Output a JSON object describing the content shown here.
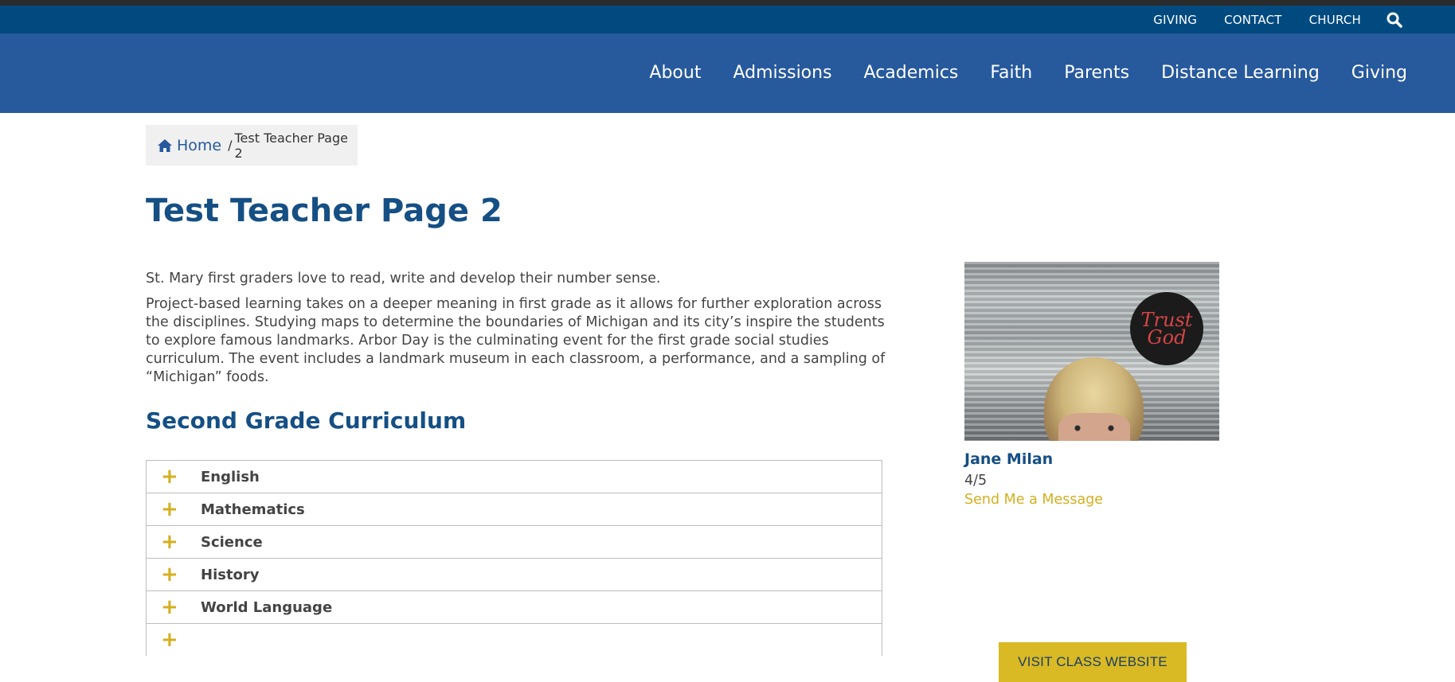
{
  "top_bar": {
    "links": [
      "GIVING",
      "CONTACT",
      "CHURCH"
    ]
  },
  "main_nav": {
    "items": [
      "About",
      "Admissions",
      "Academics",
      "Faith",
      "Parents",
      "Distance Learning",
      "Giving"
    ]
  },
  "breadcrumb": {
    "home": "Home",
    "separator": "/",
    "current": "Test Teacher Page 2"
  },
  "page": {
    "title": "Test Teacher Page 2",
    "intro_1": "St. Mary first graders love to read, write and develop their number sense.",
    "intro_2": "Project-based learning takes on a deeper meaning in first grade as it allows for further exploration across the disciplines. Studying maps to determine the boundaries of Michigan and its city’s inspire the students to explore famous landmarks. Arbor Day is the culminating event for the first grade social studies curriculum. The event includes a landmark museum in each classroom, a performance, and a sampling of “Michigan” foods.",
    "curriculum_heading": "Second Grade Curriculum"
  },
  "accordion": {
    "items": [
      "English",
      "Mathematics",
      "Science",
      "History",
      "World Language"
    ]
  },
  "teacher": {
    "photo_balloon_text": "Trust God",
    "name": "Jane Milan",
    "grade": "4/5",
    "message_link": "Send Me a Message",
    "website_button": "VISIT CLASS WEBSITE"
  },
  "colors": {
    "top_bar": "#004a80",
    "nav": "#27599d",
    "heading": "#154f84",
    "accent": "#d4af1f",
    "button": "#d9ba25"
  }
}
